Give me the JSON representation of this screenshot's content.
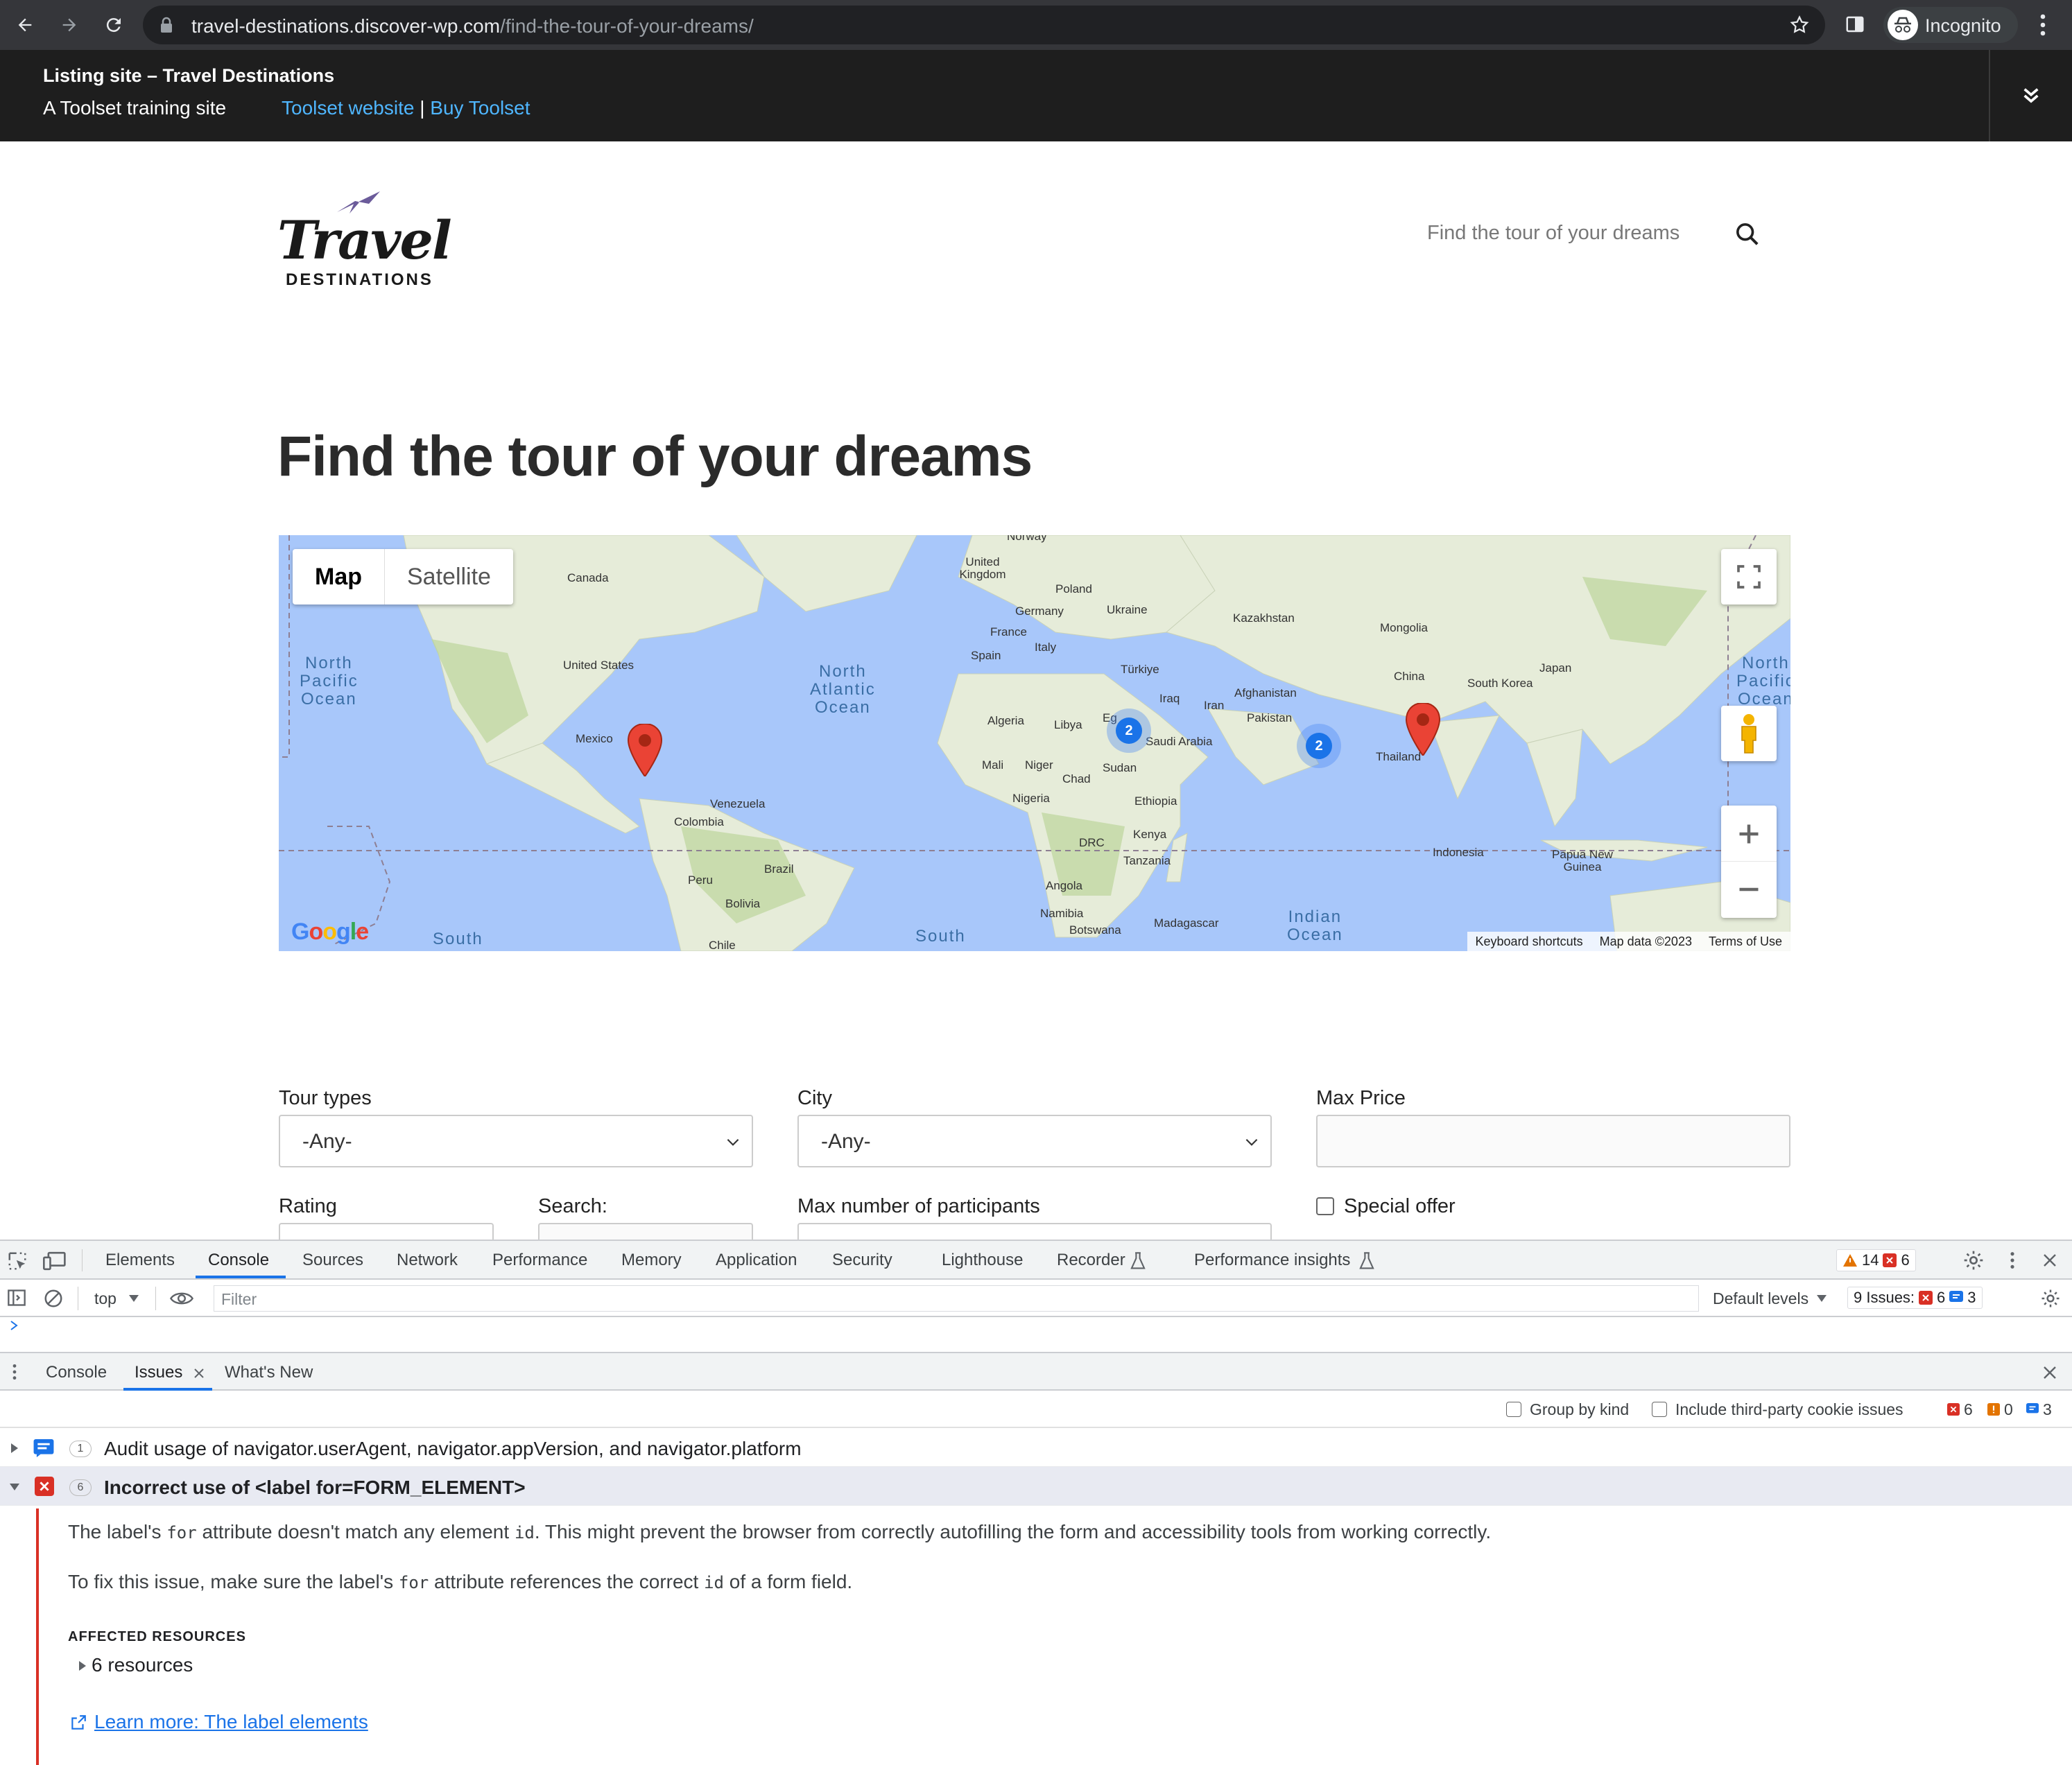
{
  "browser": {
    "url_host": "travel-destinations.discover-wp.com",
    "url_path": "/find-the-tour-of-your-dreams/",
    "profile_label": "Incognito"
  },
  "adminbar": {
    "site_title": "Listing site – Travel Destinations",
    "tagline": "A Toolset training site",
    "link1": "Toolset website",
    "separator": "|",
    "link2": "Buy Toolset"
  },
  "header": {
    "logo_word": "Travel",
    "logo_sub": "DESTINATIONS",
    "search_placeholder": "Find the tour of your dreams"
  },
  "page": {
    "title": "Find the tour of your dreams"
  },
  "map": {
    "type_map": "Map",
    "type_satellite": "Satellite",
    "footer": [
      "Keyboard shortcuts",
      "Map data ©2023",
      "Terms of Use"
    ],
    "google": "Google",
    "labels": [
      "Canada",
      "United States",
      "Mexico",
      "Venezuela",
      "Colombia",
      "Peru",
      "Brazil",
      "Bolivia",
      "Chile",
      "United Kingdom",
      "Poland",
      "Germany",
      "Ukraine",
      "France",
      "Italy",
      "Spain",
      "Kazakhstan",
      "Mongolia",
      "Türkiye",
      "Iraq",
      "Iran",
      "Afghanistan",
      "Pakistan",
      "China",
      "South Korea",
      "Japan",
      "Algeria",
      "Libya",
      "Eg",
      "Saudi Arabia",
      "Mali",
      "Niger",
      "Chad",
      "Sudan",
      "Nigeria",
      "Ethiopia",
      "Kenya",
      "DRC",
      "Tanzania",
      "Angola",
      "Namibia",
      "Botswana",
      "Madagascar",
      "Thailand",
      "Indonesia",
      "Papua New Guinea",
      "Norway"
    ],
    "oceans": [
      "North Pacific Ocean",
      "North Atlantic Ocean",
      "North Pacific Ocean",
      "Indian Ocean",
      "South",
      "South"
    ],
    "clusters": [
      "2",
      "2"
    ]
  },
  "form": {
    "tour_types_label": "Tour types",
    "tour_types_value": "-Any-",
    "city_label": "City",
    "city_value": "-Any-",
    "max_price_label": "Max Price",
    "rating_label": "Rating",
    "search_label": "Search:",
    "participants_label": "Max number of participants",
    "special_offer_label": "Special offer"
  },
  "devtools": {
    "tabs": [
      "Elements",
      "Console",
      "Sources",
      "Network",
      "Performance",
      "Memory",
      "Application",
      "Security",
      "Lighthouse",
      "Recorder",
      "Performance insights"
    ],
    "warnings": "14",
    "errors": "6",
    "context": "top",
    "filter_placeholder": "Filter",
    "default_levels": "Default levels",
    "issues_label": "9 Issues:",
    "issues_errors": "6",
    "issues_info": "3",
    "drawer_tabs": [
      "Console",
      "Issues",
      "What's New"
    ],
    "group_by_kind": "Group by kind",
    "third_party": "Include third-party cookie issues",
    "counts": {
      "errors": "6",
      "warnings": "0",
      "info": "3"
    },
    "issue1": {
      "count": "1",
      "title": "Audit usage of navigator.userAgent, navigator.appVersion, and navigator.platform"
    },
    "issue2": {
      "count": "6",
      "title": "Incorrect use of <label for=FORM_ELEMENT>"
    },
    "body1_a": "The label's ",
    "body1_code1": "for",
    "body1_b": " attribute doesn't match any element ",
    "body1_code2": "id",
    "body1_c": ". This might prevent the browser from correctly autofilling the form and accessibility tools from working correctly.",
    "body2_a": "To fix this issue, make sure the label's ",
    "body2_code1": "for",
    "body2_b": " attribute references the correct ",
    "body2_code2": "id",
    "body2_c": " of a form field.",
    "affected": "AFFECTED RESOURCES",
    "resources": "6 resources",
    "learn_more": "Learn more: The label elements"
  }
}
